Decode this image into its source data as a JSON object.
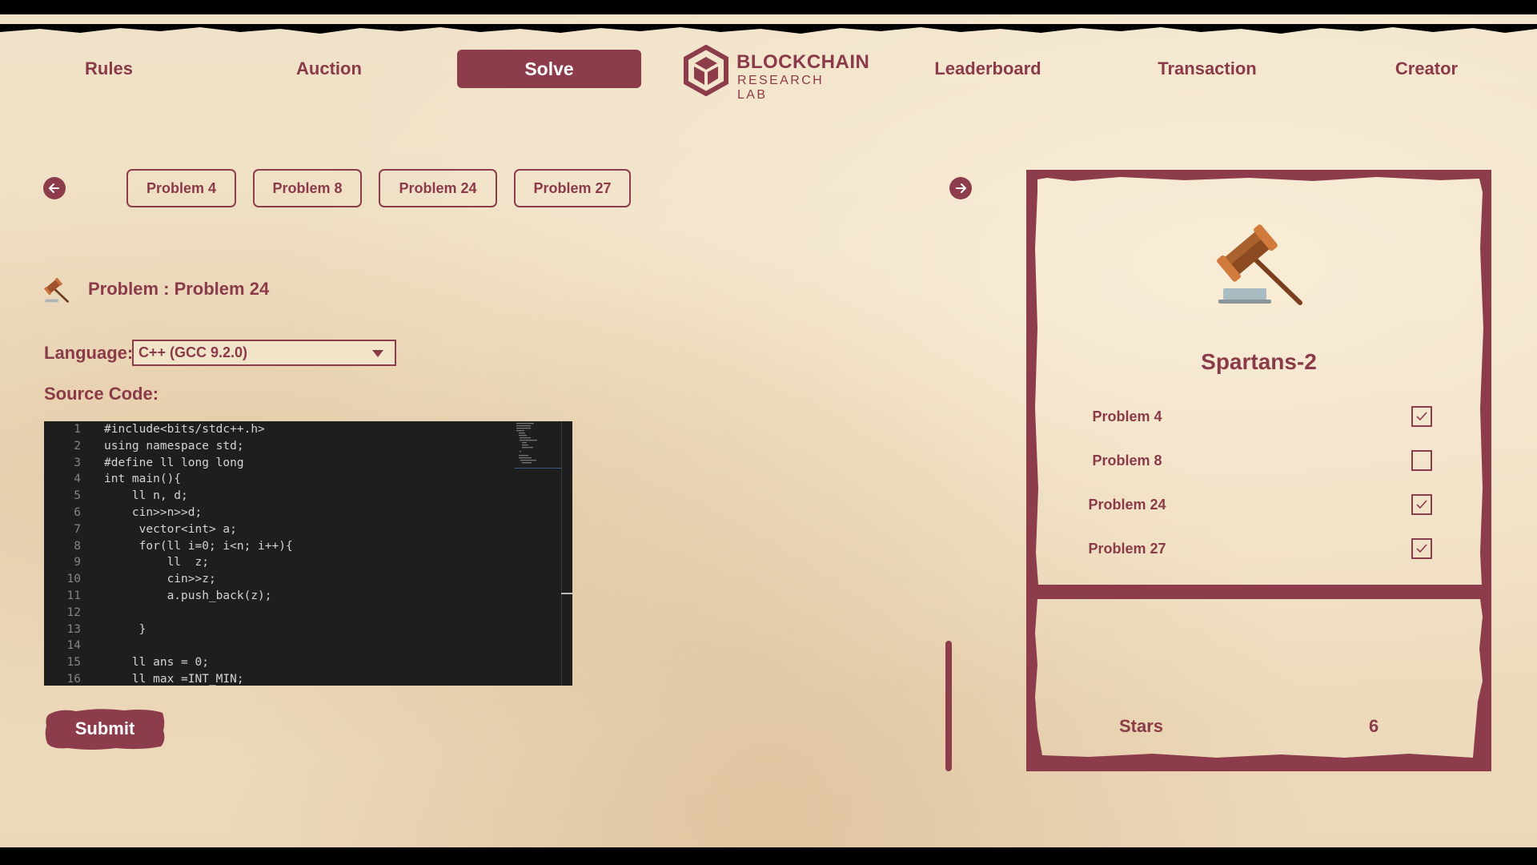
{
  "nav": {
    "items": [
      "Rules",
      "Auction",
      "Solve",
      "Leaderboard",
      "Transaction",
      "Creator"
    ],
    "active": "Solve",
    "logo_title": "BLOCKCHAIN",
    "logo_subtitle": "RESEARCH LAB"
  },
  "problem_tabs": [
    "Problem 4",
    "Problem 8",
    "Problem 24",
    "Problem 27"
  ],
  "problem": {
    "title": "Problem : Problem 24"
  },
  "editor": {
    "language_label": "Language:",
    "language_value": "C++ (GCC 9.2.0)",
    "source_label": "Source Code:",
    "lines": [
      {
        "n": "1",
        "text": "#include<bits/stdc++.h>"
      },
      {
        "n": "2",
        "text": "using namespace std;"
      },
      {
        "n": "3",
        "text": "#define ll long long"
      },
      {
        "n": "4",
        "text": "int main(){"
      },
      {
        "n": "5",
        "text": "    ll n, d;"
      },
      {
        "n": "6",
        "text": "    cin>>n>>d;"
      },
      {
        "n": "7",
        "text": "     vector<int> a;"
      },
      {
        "n": "8",
        "text": "     for(ll i=0; i<n; i++){"
      },
      {
        "n": "9",
        "text": "         ll  z;"
      },
      {
        "n": "10",
        "text": "         cin>>z;"
      },
      {
        "n": "11",
        "text": "         a.push_back(z);"
      },
      {
        "n": "12",
        "text": ""
      },
      {
        "n": "13",
        "text": "     }"
      },
      {
        "n": "14",
        "text": ""
      },
      {
        "n": "15",
        "text": "    ll ans = 0;"
      },
      {
        "n": "16",
        "text": "    ll max =INT_MIN;"
      }
    ]
  },
  "submit_label": "Submit",
  "team": {
    "name": "Spartans-2",
    "problems": [
      {
        "label": "Problem 4",
        "checked": true
      },
      {
        "label": "Problem 8",
        "checked": false
      },
      {
        "label": "Problem 24",
        "checked": true
      },
      {
        "label": "Problem 27",
        "checked": true
      }
    ],
    "stars_label": "Stars",
    "stars_value": "6"
  },
  "colors": {
    "accent": "#8d3c4c",
    "text": "#8a3a48",
    "paper": "#efdfc4",
    "editor_bg": "#1e1e1e"
  },
  "icons": {
    "prev": "arrow-left-icon",
    "next": "arrow-right-icon",
    "gavel": "gavel-icon",
    "logo": "cube-logo-icon",
    "check": "check-icon",
    "dropdown": "caret-down-icon"
  }
}
